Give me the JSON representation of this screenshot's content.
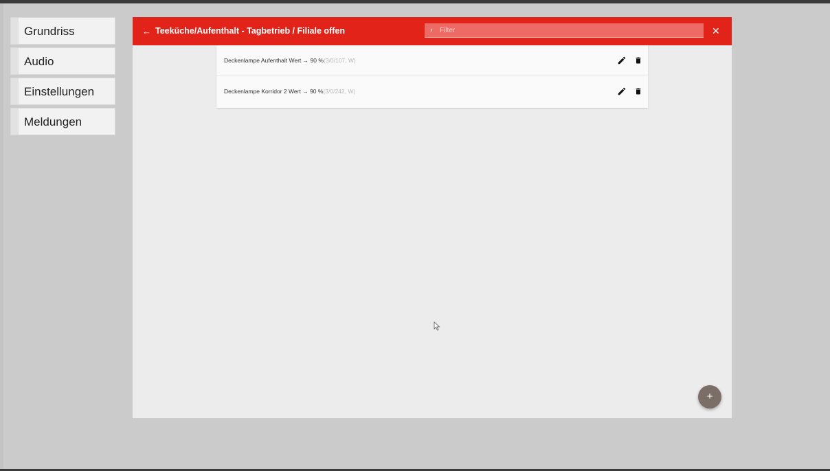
{
  "sidebar": {
    "items": [
      {
        "label": "Grundriss"
      },
      {
        "label": "Audio"
      },
      {
        "label": "Einstellungen"
      },
      {
        "label": "Meldungen"
      }
    ]
  },
  "appbar": {
    "back_icon": "←",
    "title": "Teeküche/Aufenthalt - Tagbetrieb / Filiale offen",
    "filter_icon": "›",
    "filter_placeholder": "Filter",
    "filter_value": "",
    "close_icon": "✕",
    "accent_color": "#e2231a"
  },
  "rows": [
    {
      "name": "Deckenlampe Aufenthalt Wert",
      "arrow": "→",
      "value": "90 %",
      "meta": "(3/0/107, W)"
    },
    {
      "name": "Deckenlampe Korridor 2 Wert",
      "arrow": "→",
      "value": "90 %",
      "meta": "(3/0/242, W)"
    }
  ],
  "fab": {
    "icon": "+",
    "color": "#7b6e67"
  }
}
